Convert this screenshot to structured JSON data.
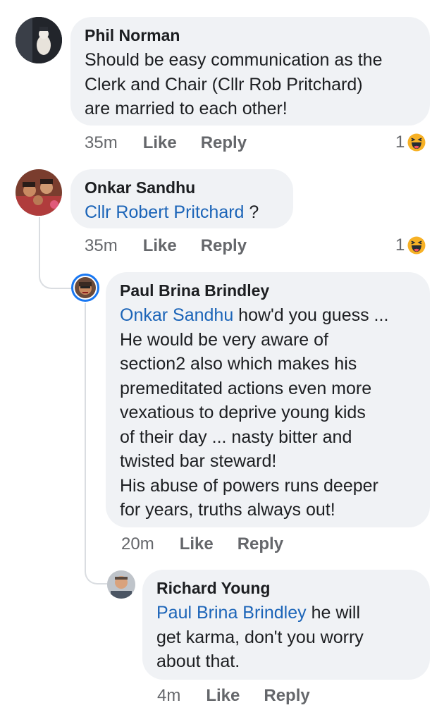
{
  "comments": [
    {
      "author": "Phil Norman",
      "lines": [
        "Should be easy communication as the",
        "Clerk and Chair (Cllr Rob Pritchard)",
        "are married to each other!"
      ],
      "time": "35m",
      "like_label": "Like",
      "reply_label": "Reply",
      "reaction_count": "1",
      "reaction_icon": "haha-emoji-icon"
    },
    {
      "author": "Onkar Sandhu",
      "mention": "Cllr Robert Pritchard",
      "after_mention": " ?",
      "time": "35m",
      "like_label": "Like",
      "reply_label": "Reply",
      "reaction_count": "1",
      "reaction_icon": "haha-emoji-icon"
    },
    {
      "author": "Paul Brina Brindley",
      "mention": "Onkar Sandhu",
      "after_mention": " how'd you guess ...",
      "lines": [
        "He would be very aware of",
        "section2 also which makes his",
        "premeditated actions even more",
        "vexatious to deprive young kids",
        "of their day ... nasty bitter and",
        "twisted bar steward!",
        "His abuse of powers runs deeper",
        "for years, truths always out!"
      ],
      "time": "20m",
      "like_label": "Like",
      "reply_label": "Reply"
    },
    {
      "author": "Richard Young",
      "mention": "Paul Brina Brindley",
      "after_mention": " he will",
      "lines": [
        "get karma, don't you worry",
        "about that."
      ],
      "time": "4m",
      "like_label": "Like",
      "reply_label": "Reply"
    }
  ],
  "colors": {
    "bubble": "#f0f2f5",
    "mention": "#1b64b8",
    "meta": "#65676b",
    "thread_line": "#dadde1",
    "story_ring": "#1877f2"
  }
}
